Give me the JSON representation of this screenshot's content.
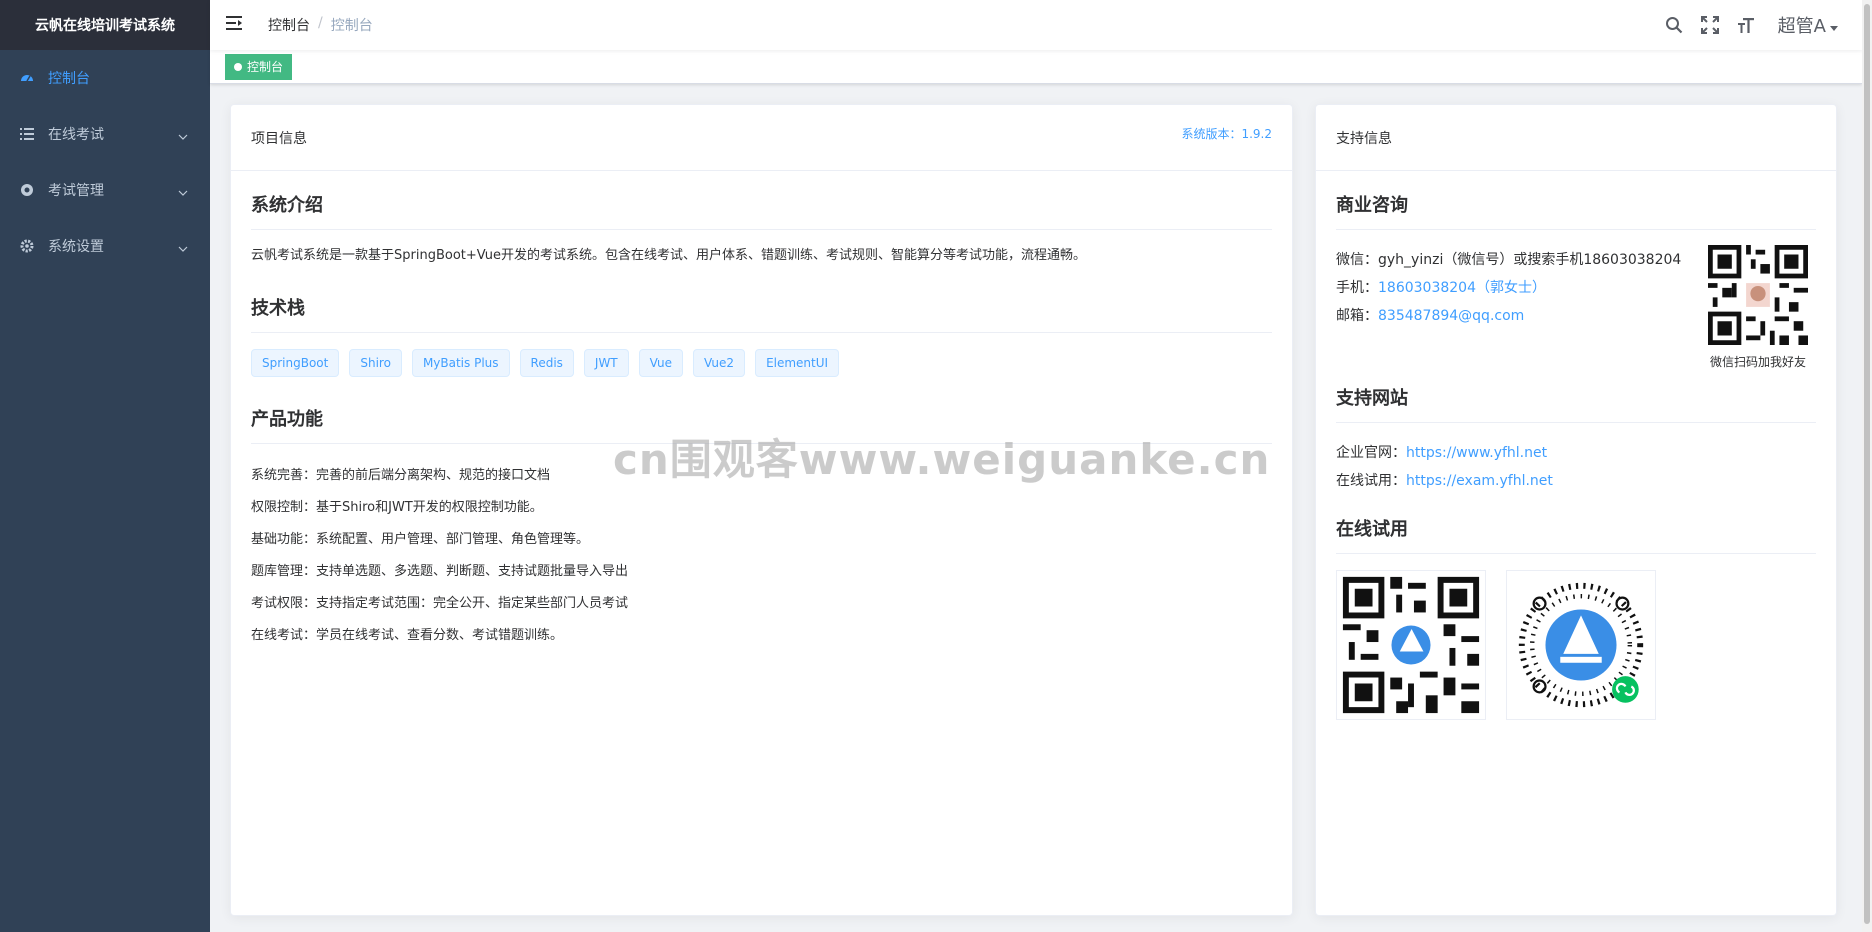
{
  "app": {
    "title": "云帆在线培训考试系统"
  },
  "sidebar": {
    "items": [
      {
        "label": "控制台",
        "icon": "dashboard-icon",
        "active": true
      },
      {
        "label": "在线考试",
        "icon": "list-icon"
      },
      {
        "label": "考试管理",
        "icon": "exam-manage-icon"
      },
      {
        "label": "系统设置",
        "icon": "gear-icon"
      }
    ]
  },
  "navbar": {
    "breadcrumb": [
      "控制台",
      "控制台"
    ],
    "user": "超管A"
  },
  "tags": {
    "active": "控制台"
  },
  "project": {
    "header": "项目信息",
    "version": "系统版本：1.9.2",
    "intro_title": "系统介绍",
    "intro_text": "云帆考试系统是一款基于SpringBoot+Vue开发的考试系统。包含在线考试、用户体系、错题训练、考试规则、智能算分等考试功能，流程通畅。",
    "stack_title": "技术栈",
    "stack": [
      "SpringBoot",
      "Shiro",
      "MyBatis Plus",
      "Redis",
      "JWT",
      "Vue",
      "Vue2",
      "ElementUI"
    ],
    "features_title": "产品功能",
    "features": [
      "系统完善：完善的前后端分离架构、规范的接口文档",
      "权限控制：基于Shiro和JWT开发的权限控制功能。",
      "基础功能：系统配置、用户管理、部门管理、角色管理等。",
      "题库管理：支持单选题、多选题、判断题、支持试题批量导入导出",
      "考试权限：支持指定考试范围：完全公开、指定某些部门人员考试",
      "在线考试：学员在线考试、查看分数、考试错题训练。"
    ]
  },
  "support": {
    "header": "支持信息",
    "biz_title": "商业咨询",
    "wechat_label": "微信：",
    "wechat_value": "gyh_yinzi（微信号）或搜索手机18603038204",
    "phone_label": "手机：",
    "phone_value": "18603038204（郭女士）",
    "email_label": "邮箱：",
    "email_value": "835487894@qq.com",
    "qr_caption": "微信扫码加我好友",
    "site_title": "支持网站",
    "official_label": "企业官网：",
    "official_url": "https://www.yfhl.net",
    "trial_label": "在线试用：",
    "trial_url": "https://exam.yfhl.net",
    "online_title": "在线试用"
  },
  "watermark": "cn围观客www.weiguanke.cn",
  "colors": {
    "sidebar": "#304156",
    "accent": "#409eff",
    "tag": "#42b983"
  }
}
